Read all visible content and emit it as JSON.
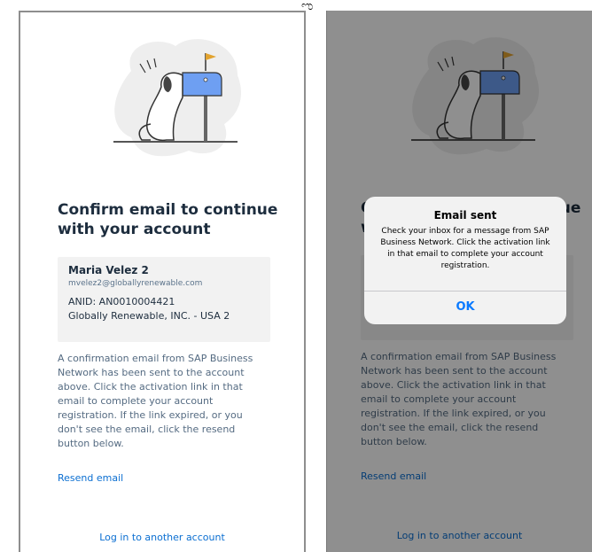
{
  "title": "Confirm email to continue with your account",
  "account": {
    "name": "Maria Velez 2",
    "email": "mvelez2@globallyrenewable.com",
    "anid": "ANID: AN0010004421",
    "company": "Globally Renewable, INC. - USA 2"
  },
  "body_text": "A confirmation email from SAP Business Network has been sent to the account above. Click the activation link in that email to complete your account registration. If the link expired, or you don't see the email, click the resend button below.",
  "resend_label": "Resend email",
  "login_label": "Log in to another account",
  "alert": {
    "title": "Email sent",
    "message": "Check your inbox for a message from SAP Business Network. Click the activation link in that email to complete your account registration.",
    "ok_label": "OK"
  },
  "top_glyph": "ಌ",
  "colors": {
    "accent": "#0a6ed1",
    "mailbox": "#6e9ff2",
    "flag": "#e2a32f",
    "blob": "#eeeeee"
  },
  "icons": [
    "dog-mailbox-illustration"
  ]
}
